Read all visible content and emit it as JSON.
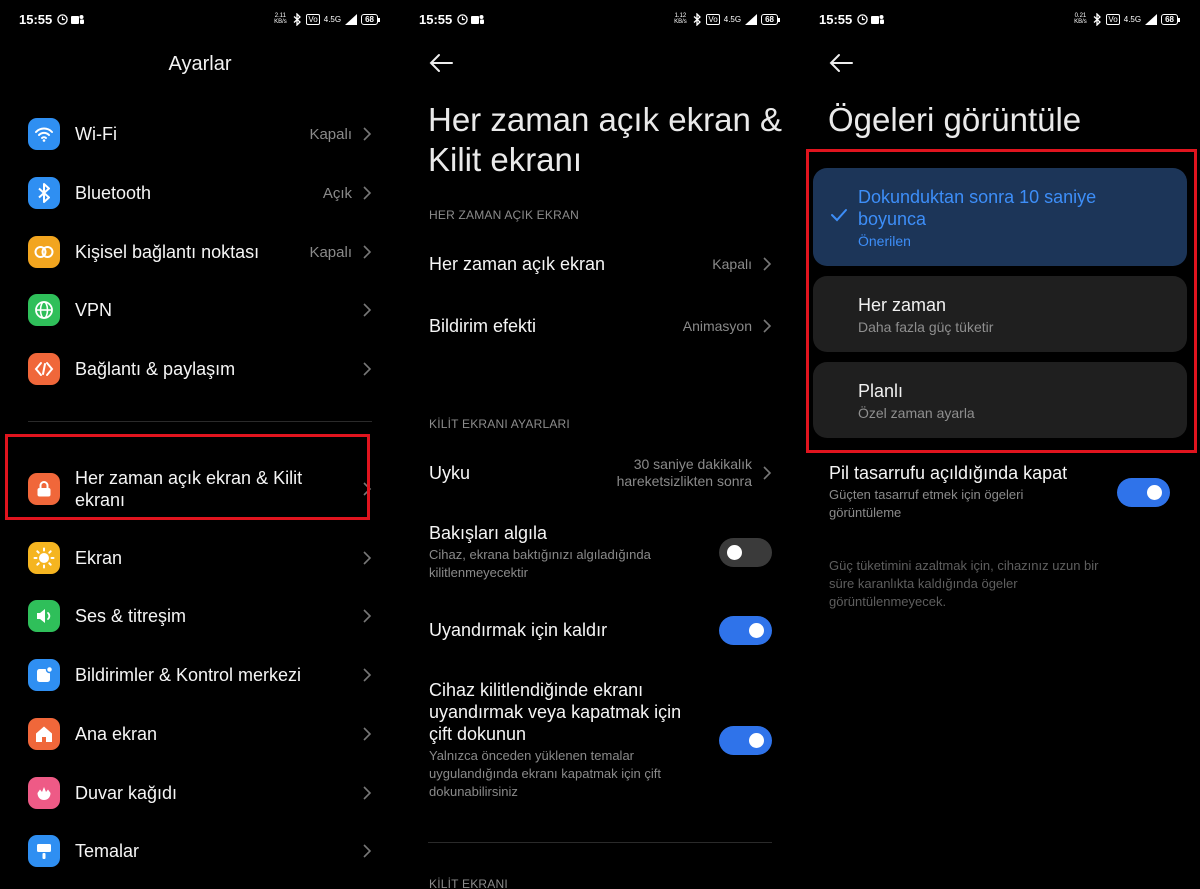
{
  "status": [
    {
      "time": "15:55",
      "speed_top": "2.11",
      "speed_bottom": "KB/s",
      "vo": "Vo",
      "lte": "4.5G",
      "battery": "68"
    },
    {
      "time": "15:55",
      "speed_top": "1.12",
      "speed_bottom": "KB/s",
      "vo": "Vo",
      "lte": "4.5G",
      "battery": "68"
    },
    {
      "time": "15:55",
      "speed_top": "0.21",
      "speed_bottom": "KB/s",
      "vo": "Vo",
      "lte": "4.5G",
      "battery": "68"
    }
  ],
  "settings": {
    "title": "Ayarlar",
    "items": [
      {
        "label": "Wi-Fi",
        "value": "Kapalı",
        "icon": "wifi-icon",
        "color": "#2f8ff2"
      },
      {
        "label": "Bluetooth",
        "value": "Açık",
        "icon": "bluetooth-icon",
        "color": "#2f8ff2"
      },
      {
        "label": "Kişisel bağlantı noktası",
        "value": "Kapalı",
        "icon": "hotspot-icon",
        "color": "#f2a51f"
      },
      {
        "label": "VPN",
        "value": "",
        "icon": "globe-icon",
        "color": "#2fbf5a"
      },
      {
        "label": "Bağlantı & paylaşım",
        "value": "",
        "icon": "share-icon",
        "color": "#f0673a"
      },
      {
        "label": "Her zaman açık ekran & Kilit ekranı",
        "value": "",
        "icon": "lock-icon",
        "color": "#f0673a"
      },
      {
        "label": "Ekran",
        "value": "",
        "icon": "sun-icon",
        "color": "#f5b520"
      },
      {
        "label": "Ses & titreşim",
        "value": "",
        "icon": "speaker-icon",
        "color": "#2fbf5a"
      },
      {
        "label": "Bildirimler & Kontrol merkezi",
        "value": "",
        "icon": "notification-icon",
        "color": "#2f8ff2"
      },
      {
        "label": "Ana ekran",
        "value": "",
        "icon": "home-icon",
        "color": "#f0673a"
      },
      {
        "label": "Duvar kağıdı",
        "value": "",
        "icon": "flower-icon",
        "color": "#ee5a86"
      },
      {
        "label": "Temalar",
        "value": "",
        "icon": "brush-icon",
        "color": "#2f8ff2"
      }
    ]
  },
  "aod": {
    "title": "Her zaman açık ekran & Kilit ekranı",
    "section1": "HER ZAMAN AÇIK EKRAN",
    "aod_label": "Her zaman açık ekran",
    "aod_value": "Kapalı",
    "effect_label": "Bildirim efekti",
    "effect_value": "Animasyon",
    "section2": "KİLİT EKRANI AYARLARI",
    "sleep_label": "Uyku",
    "sleep_value": "30 saniye dakikalık hareketsizlikten sonra",
    "glance_label": "Bakışları algıla",
    "glance_sub": "Cihaz, ekrana baktığınızı algıladığında kilitlenmeyecektir",
    "glance_on": false,
    "raise_label": "Uyandırmak için kaldır",
    "raise_on": true,
    "double_label": "Cihaz kilitlendiğinde ekranı uyandırmak veya kapatmak için çift dokunun",
    "double_sub": "Yalnızca önceden yüklenen temalar uygulandığında ekranı kapatmak için çift dokunabilirsiniz",
    "double_on": true,
    "section3": "KİLİT EKRANI"
  },
  "display": {
    "title": "Ögeleri görüntüle",
    "options": [
      {
        "title": "Dokunduktan sonra 10 saniye boyunca",
        "sub": "Önerilen",
        "selected": true
      },
      {
        "title": "Her zaman",
        "sub": "Daha fazla güç tüketir",
        "selected": false
      },
      {
        "title": "Planlı",
        "sub": "Özel zaman ayarla",
        "selected": false
      }
    ],
    "battery_label": "Pil tasarrufu açıldığında kapat",
    "battery_sub": "Güçten tasarruf etmek için ögeleri görüntüleme",
    "battery_on": true,
    "note": "Güç tüketimini azaltmak için, cihazınız uzun bir süre karanlıkta kaldığında ögeler görüntülenmeyecek."
  },
  "colors": {
    "accent": "#2f73ea",
    "highlight": "#e0141e",
    "selected_card": "#1c3558",
    "selected_text": "#3d8ef8"
  }
}
